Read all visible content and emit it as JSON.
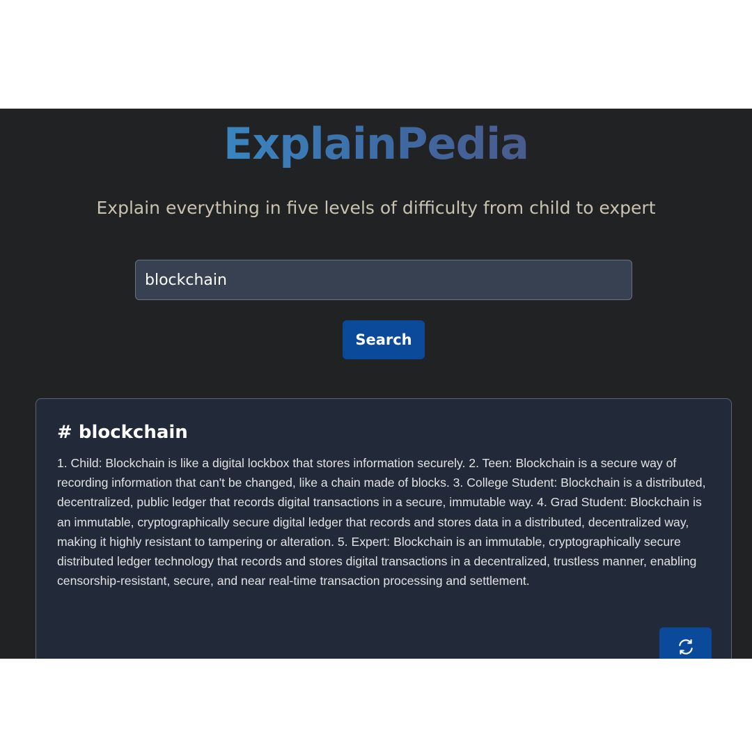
{
  "app": {
    "title": "ExplainPedia",
    "tagline": "Explain everything in five levels of difficulty from child to expert"
  },
  "search": {
    "value": "blockchain",
    "button_label": "Search"
  },
  "result": {
    "heading": "# blockchain",
    "text": "1. Child: Blockchain is like a digital lockbox that stores information securely. 2. Teen: Blockchain is a secure way of recording information that can't be changed, like a chain made of blocks. 3. College Student: Blockchain is a distributed, decentralized, public ledger that records digital transactions in a secure, immutable way. 4. Grad Student: Blockchain is an immutable, cryptographically secure digital ledger that records and stores data in a distributed, decentralized way, making it highly resistant to tampering or alteration. 5. Expert: Blockchain is an immutable, cryptographically secure distributed ledger technology that records and stores digital transactions in a decentralized, trustless manner, enabling censorship-resistant, secure, and near real-time transaction processing and settlement.",
    "refresh_icon": "refresh-icon"
  },
  "colors": {
    "background": "#202224",
    "card": "#222a3a",
    "input": "#374151",
    "button": "#0b4a9a",
    "brand_start": "#3a86c0",
    "brand_end": "#4a5b8c",
    "tagline": "#c9c2b1"
  }
}
